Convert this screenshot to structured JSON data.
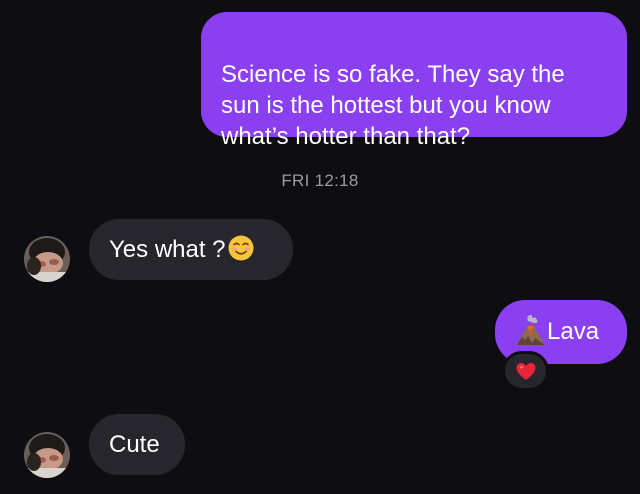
{
  "messages": [
    {
      "direction": "outgoing",
      "text": "Science is so fake. They say the\nsun is the hottest but you know\nwhat’s hotter than that?"
    },
    {
      "direction": "incoming",
      "text": "Yes what ?",
      "emoji": "smiling-face-icon"
    },
    {
      "direction": "outgoing",
      "text": "Lava",
      "emoji": "volcano-icon",
      "reaction": "red-heart-icon"
    },
    {
      "direction": "incoming",
      "text": "Cute"
    }
  ],
  "timestamp": "FRI 12:18",
  "colors": {
    "background": "#0d0d12",
    "outgoing_bubble": "#8a3ff0",
    "incoming_bubble": "#26262c",
    "timestamp_text": "#9a9aa3"
  }
}
